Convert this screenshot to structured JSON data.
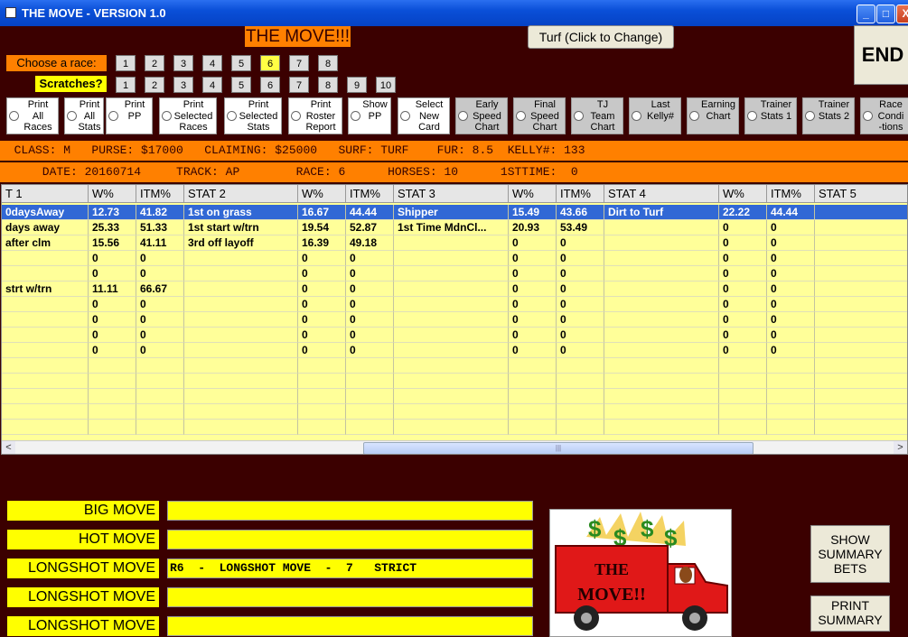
{
  "window": {
    "title": "THE MOVE - VERSION 1.0",
    "minimize": "_",
    "maximize": "□",
    "close": "X"
  },
  "header": {
    "main_title": "THE MOVE!!!",
    "turf_button": "Turf (Click to Change)",
    "end_button": "END"
  },
  "race_select": {
    "label": "Choose  a race:",
    "numbers": [
      "1",
      "2",
      "3",
      "4",
      "5",
      "6",
      "7",
      "8"
    ],
    "selected": "6"
  },
  "scratches": {
    "label": "Scratches?",
    "numbers": [
      "1",
      "2",
      "3",
      "4",
      "5",
      "6",
      "7",
      "8",
      "9",
      "10"
    ]
  },
  "options": [
    {
      "label": "Print\nAll\nRaces",
      "style": "white"
    },
    {
      "label": "Print\nAll\nStats",
      "style": "white"
    },
    {
      "label": "Print\nPP",
      "style": "white"
    },
    {
      "label": "Print\nSelected\nRaces",
      "style": "white"
    },
    {
      "label": "Print\nSelected\nStats",
      "style": "white"
    },
    {
      "label": "Print\nRoster\nReport",
      "style": "white"
    },
    {
      "label": "Show\nPP",
      "style": "white"
    },
    {
      "label": "Select\nNew\nCard",
      "style": "white"
    },
    {
      "label": "Early\nSpeed\nChart",
      "style": "gray"
    },
    {
      "label": "Final\nSpeed\nChart",
      "style": "gray"
    },
    {
      "label": "TJ\nTeam\nChart",
      "style": "gray"
    },
    {
      "label": "Last\nKelly#",
      "style": "gray"
    },
    {
      "label": "Earning\nChart",
      "style": "gray"
    },
    {
      "label": "Trainer\nStats 1",
      "style": "gray"
    },
    {
      "label": "Trainer\nStats 2",
      "style": "gray"
    },
    {
      "label": "Race\nCondi\n-tions",
      "style": "gray"
    }
  ],
  "info1": "  CLASS: M   PURSE: $17000   CLAIMING: $25000   SURF: TURF    FUR: 8.5  KELLY#: 133",
  "info2": "      DATE: 20160714     TRACK: AP        RACE: 6      HORSES: 10      1STTIME:  0",
  "grid": {
    "headers": [
      "T 1",
      "W%",
      "ITM%",
      "STAT 2",
      "W%",
      "ITM%",
      "STAT 3",
      "W%",
      "ITM%",
      "STAT 4",
      "W%",
      "ITM%",
      "STAT 5"
    ],
    "rows": [
      [
        "0daysAway",
        "12.73",
        "41.82",
        "1st on grass",
        "16.67",
        "44.44",
        "Shipper",
        "15.49",
        "43.66",
        "Dirt to Turf",
        "22.22",
        "44.44",
        ""
      ],
      [
        "days away",
        "25.33",
        "51.33",
        "1st start w/trn",
        "19.54",
        "52.87",
        "1st Time MdnCl...",
        "20.93",
        "53.49",
        "",
        "0",
        "0",
        ""
      ],
      [
        "after clm",
        "15.56",
        "41.11",
        "3rd off layoff",
        "16.39",
        "49.18",
        "",
        "0",
        "0",
        "",
        "0",
        "0",
        ""
      ],
      [
        "",
        "0",
        "0",
        "",
        "0",
        "0",
        "",
        "0",
        "0",
        "",
        "0",
        "0",
        ""
      ],
      [
        "",
        "0",
        "0",
        "",
        "0",
        "0",
        "",
        "0",
        "0",
        "",
        "0",
        "0",
        ""
      ],
      [
        "strt w/trn",
        "11.11",
        "66.67",
        "",
        "0",
        "0",
        "",
        "0",
        "0",
        "",
        "0",
        "0",
        ""
      ],
      [
        "",
        "0",
        "0",
        "",
        "0",
        "0",
        "",
        "0",
        "0",
        "",
        "0",
        "0",
        ""
      ],
      [
        "",
        "0",
        "0",
        "",
        "0",
        "0",
        "",
        "0",
        "0",
        "",
        "0",
        "0",
        ""
      ],
      [
        "",
        "0",
        "0",
        "",
        "0",
        "0",
        "",
        "0",
        "0",
        "",
        "0",
        "0",
        ""
      ],
      [
        "",
        "0",
        "0",
        "",
        "0",
        "0",
        "",
        "0",
        "0",
        "",
        "0",
        "0",
        ""
      ],
      [
        "",
        "",
        "",
        "",
        "",
        "",
        "",
        "",
        "",
        "",
        "",
        "",
        ""
      ],
      [
        "",
        "",
        "",
        "",
        "",
        "",
        "",
        "",
        "",
        "",
        "",
        "",
        ""
      ],
      [
        "",
        "",
        "",
        "",
        "",
        "",
        "",
        "",
        "",
        "",
        "",
        "",
        ""
      ],
      [
        "",
        "",
        "",
        "",
        "",
        "",
        "",
        "",
        "",
        "",
        "",
        "",
        ""
      ],
      [
        "",
        "",
        "",
        "",
        "",
        "",
        "",
        "",
        "",
        "",
        "",
        "",
        ""
      ]
    ],
    "scroll_left": "<",
    "scroll_right": ">",
    "scroll_grip": "|||"
  },
  "moves": [
    {
      "label": "BIG MOVE",
      "value": ""
    },
    {
      "label": "HOT MOVE",
      "value": ""
    },
    {
      "label": "LONGSHOT MOVE",
      "value": "R6  -  LONGSHOT MOVE  -  7   STRICT"
    },
    {
      "label": "LONGSHOT MOVE",
      "value": ""
    },
    {
      "label": "LONGSHOT MOVE",
      "value": ""
    }
  ],
  "logo": {
    "text_line1": "THE",
    "text_line2": "MOVE!!",
    "money_sign": "$"
  },
  "side_buttons": {
    "show_summary": "SHOW\nSUMMARY\nBETS",
    "print_summary": "PRINT\nSUMMARY"
  }
}
